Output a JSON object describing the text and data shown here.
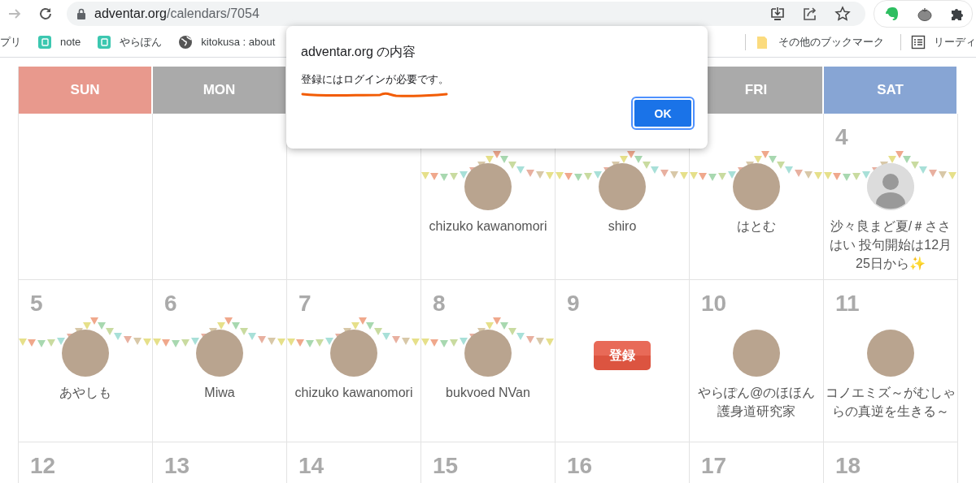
{
  "browser": {
    "url_domain": "adventar.org",
    "url_path": "/calendars/7054",
    "bookmarks": [
      {
        "label": "プリ",
        "kind": "none"
      },
      {
        "label": "note",
        "kind": "page"
      },
      {
        "label": "やらぽん",
        "kind": "page"
      },
      {
        "label": "kitokusa : about",
        "kind": "globe"
      }
    ],
    "other_bookmarks": "その他のブックマーク",
    "reading_list": "リーディ"
  },
  "calendar": {
    "headers_left": [
      {
        "label": "SUN",
        "color": "#e8998d"
      },
      {
        "label": "MON",
        "color": "#aaaaaa"
      }
    ],
    "headers_right": [
      {
        "label": "FRI",
        "color": "#aaaaaa"
      },
      {
        "label": "SAT",
        "color": "#87a5d4"
      }
    ],
    "weeks": [
      [
        {
          "decorated": false
        },
        {
          "decorated": false
        },
        {
          "decorated": false
        },
        {
          "decorated": true,
          "entry": {
            "name": "chizuko kawanomori",
            "default_avatar": false
          }
        },
        {
          "decorated": true,
          "entry": {
            "name": "shiro",
            "default_avatar": false
          }
        },
        {
          "decorated": true,
          "entry": {
            "name": "はとむ",
            "default_avatar": false
          }
        },
        {
          "day": "4",
          "decorated": true,
          "entry": {
            "name": "沙々良まど夏/＃ささはい 投句開始は12月25日から✨",
            "default_avatar": true
          }
        }
      ],
      [
        {
          "day": "5",
          "decorated": true,
          "entry": {
            "name": "あやしも",
            "default_avatar": false
          }
        },
        {
          "day": "6",
          "decorated": true,
          "entry": {
            "name": "Miwa",
            "default_avatar": false
          }
        },
        {
          "day": "7",
          "decorated": true,
          "entry": {
            "name": "chizuko kawanomori",
            "default_avatar": false
          }
        },
        {
          "day": "8",
          "decorated": true,
          "entry": {
            "name": "bukvoed NVan",
            "default_avatar": false
          }
        },
        {
          "day": "9",
          "decorated": false,
          "register": "登録"
        },
        {
          "day": "10",
          "decorated": false,
          "entry": {
            "name": "やらぽん@のほほん護身道研究家",
            "default_avatar": false
          }
        },
        {
          "day": "11",
          "decorated": false,
          "entry": {
            "name": "コノエミズ～がむしゃらの真逆を生きる～",
            "default_avatar": false
          }
        }
      ],
      [
        {
          "day": "12",
          "decorated": false
        },
        {
          "day": "13",
          "decorated": false
        },
        {
          "day": "14",
          "decorated": false
        },
        {
          "day": "15",
          "decorated": false
        },
        {
          "day": "16",
          "decorated": false
        },
        {
          "day": "17",
          "decorated": false
        },
        {
          "day": "18",
          "decorated": false
        }
      ]
    ]
  },
  "dialog": {
    "title": "adventar.org の内容",
    "message": "登録にはログインが必要です。",
    "button": "OK"
  }
}
